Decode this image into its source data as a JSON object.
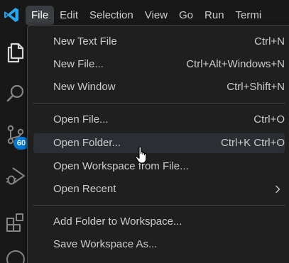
{
  "menubar": {
    "items": [
      {
        "label": "File",
        "active": true
      },
      {
        "label": "Edit"
      },
      {
        "label": "Selection"
      },
      {
        "label": "View"
      },
      {
        "label": "Go"
      },
      {
        "label": "Run"
      },
      {
        "label": "Termi"
      }
    ]
  },
  "activitybar": {
    "icons": [
      "explorer-icon",
      "search-icon",
      "source-control-icon",
      "run-debug-icon",
      "extensions-icon"
    ],
    "source_control_badge": "60"
  },
  "file_menu": {
    "items": [
      {
        "label": "New Text File",
        "shortcut": "Ctrl+N"
      },
      {
        "label": "New File...",
        "shortcut": "Ctrl+Alt+Windows+N"
      },
      {
        "label": "New Window",
        "shortcut": "Ctrl+Shift+N"
      },
      {
        "label": "Open File...",
        "shortcut": "Ctrl+O"
      },
      {
        "label": "Open Folder...",
        "shortcut": "Ctrl+K Ctrl+O",
        "hovered": true
      },
      {
        "label": "Open Workspace from File...",
        "shortcut": ""
      },
      {
        "label": "Open Recent",
        "shortcut": "",
        "submenu": true
      },
      {
        "label": "Add Folder to Workspace...",
        "shortcut": ""
      },
      {
        "label": "Save Workspace As...",
        "shortcut": ""
      }
    ]
  },
  "colors": {
    "accent": "#0078d4",
    "logo": "#23a9f2",
    "menu_text": "#cccccc",
    "menu_bg": "#1f1f1f",
    "hover_bg": "#2b2e33"
  }
}
